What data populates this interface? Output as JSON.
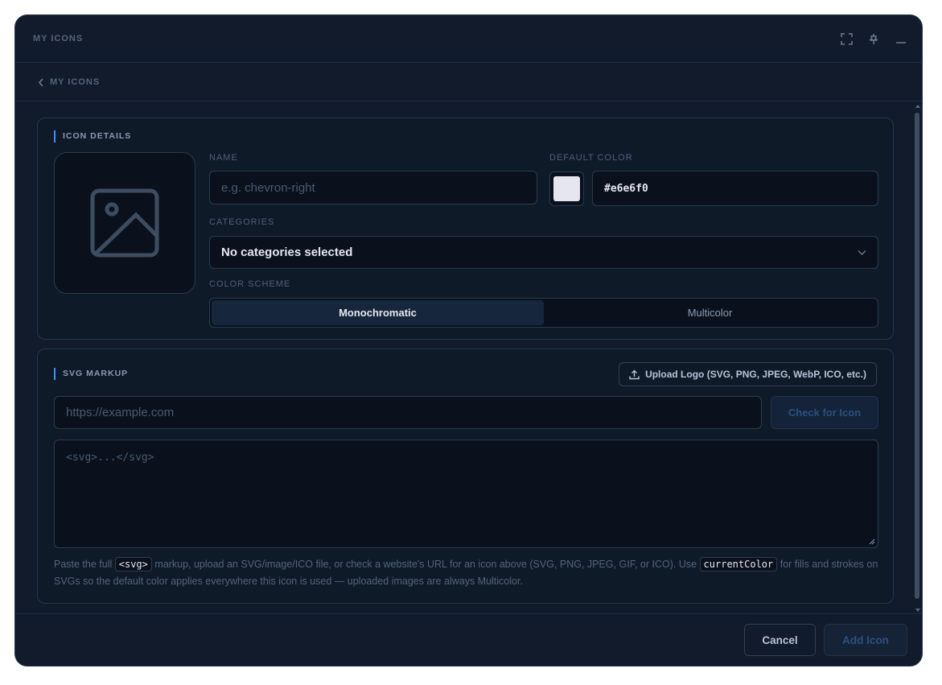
{
  "window": {
    "title": "MY ICONS"
  },
  "breadcrumb": {
    "back_label": "MY ICONS"
  },
  "details": {
    "section_title": "ICON DETAILS",
    "name_label": "NAME",
    "name_placeholder": "e.g. chevron-right",
    "default_color_label": "DEFAULT COLOR",
    "default_color_value": "#e6e6f0",
    "categories_label": "CATEGORIES",
    "categories_value": "No categories selected",
    "color_scheme_label": "COLOR SCHEME",
    "color_scheme_options": [
      "Monochromatic",
      "Multicolor"
    ],
    "color_scheme_selected": "Monochromatic"
  },
  "svg": {
    "section_title": "SVG MARKUP",
    "upload_label": "Upload Logo (SVG, PNG, JPEG, WebP, ICO, etc.)",
    "url_placeholder": "https://example.com",
    "check_label": "Check for Icon",
    "markup_placeholder": "<svg>...</svg>",
    "help": {
      "part1": "Paste the full ",
      "code1": "<svg>",
      "part2": " markup, upload an SVG/image/ICO file, or check a website's URL for an icon above (SVG, PNG, JPEG, GIF, or ICO). Use ",
      "code2": "currentColor",
      "part3": " for fills and strokes on SVGs so the default color applies everywhere this icon is used — uploaded images are always Multicolor."
    }
  },
  "footer": {
    "cancel_label": "Cancel",
    "add_label": "Add Icon"
  },
  "icons": {
    "window_controls": [
      "maximize-icon",
      "pin-icon",
      "minimize-icon"
    ],
    "back": "chevron-left-icon",
    "preview": "image-placeholder-icon",
    "select": "chevron-down-icon",
    "upload": "upload-icon"
  },
  "colors": {
    "accent": "#3f8cff",
    "background": "#111b2b",
    "panel": "#0f1a29"
  }
}
